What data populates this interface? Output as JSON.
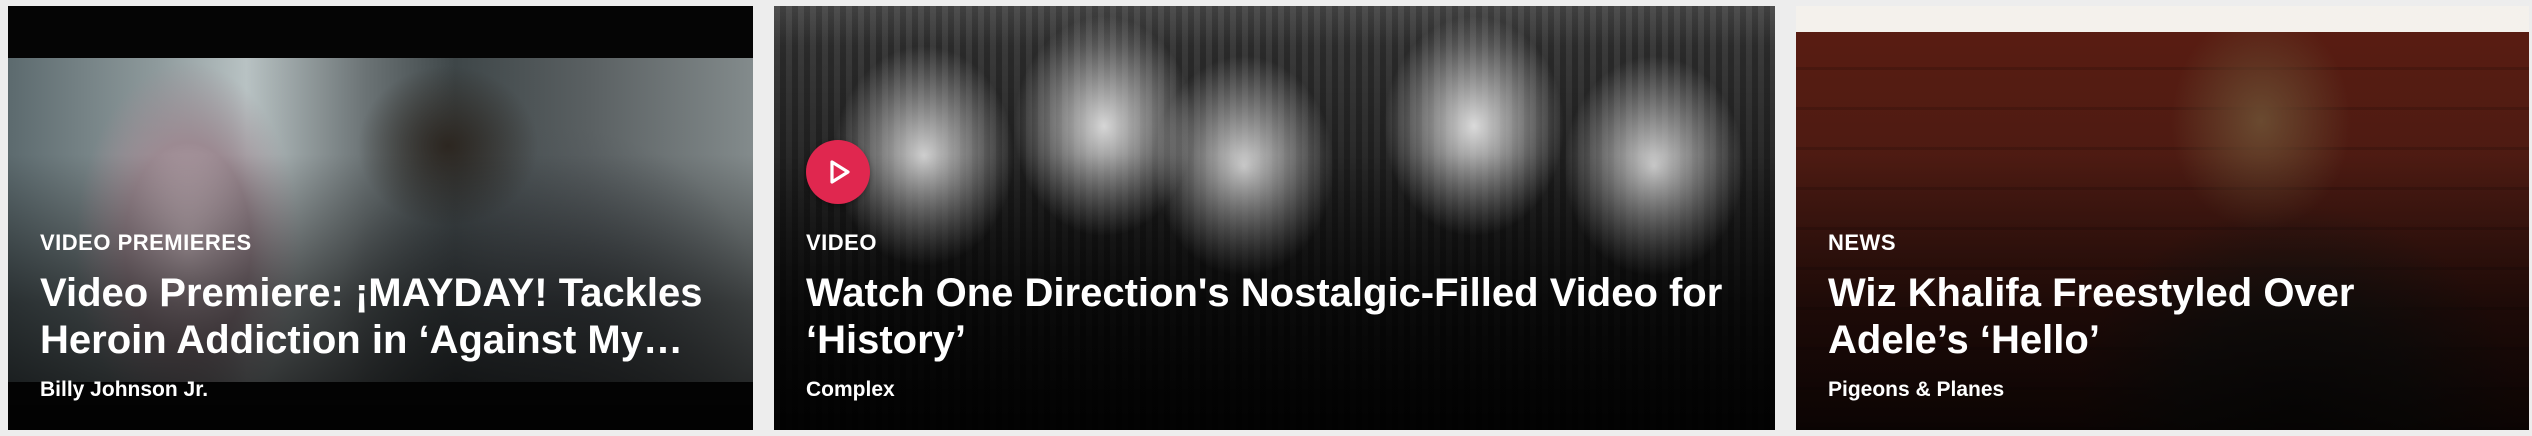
{
  "cards": [
    {
      "category": "VIDEO PREMIERES",
      "headline": "Video Premiere: ¡MAYDAY! Tackles Heroin Addiction in ‘Against My…",
      "source": "Billy Johnson Jr."
    },
    {
      "category": "VIDEO",
      "headline": "Watch One Direction's Nostalgic-Filled Video for ‘History’",
      "source": "Complex",
      "play_icon": "play-icon",
      "play_color": "#e0274f"
    },
    {
      "category": "NEWS",
      "headline": "Wiz Khalifa Freestyled Over Adele’s ‘Hello’",
      "source": "Pigeons & Planes"
    }
  ]
}
